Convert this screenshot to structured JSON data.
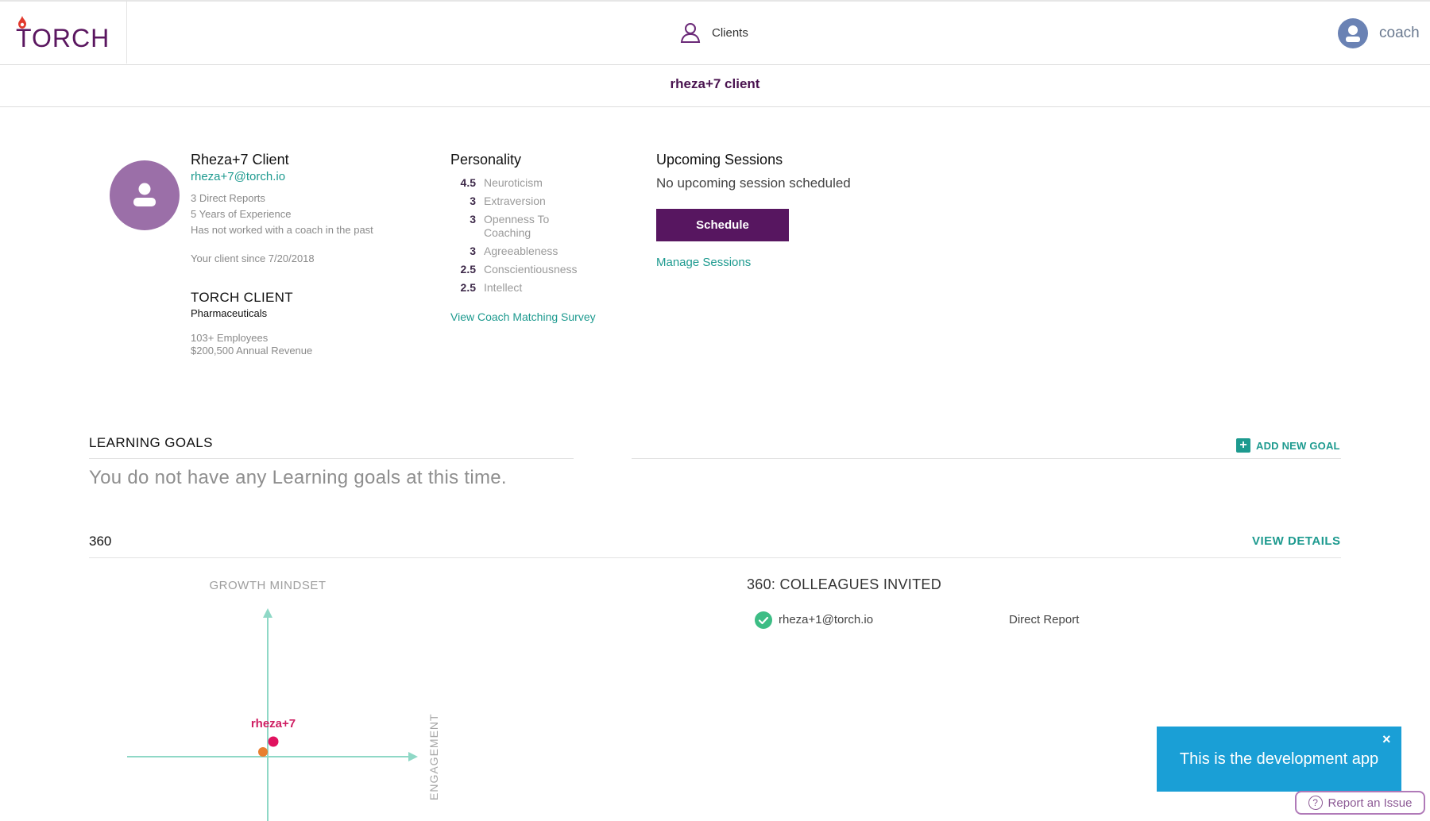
{
  "header": {
    "logo_text": "TORCH",
    "nav_clients": "Clients",
    "user_label": "coach"
  },
  "subheader": {
    "title": "rheza+7 client"
  },
  "client": {
    "name": "Rheza+7 Client",
    "email": "rheza+7@torch.io",
    "direct_reports": "3 Direct Reports",
    "experience": "5 Years of Experience",
    "coach_history": "Has not worked with a coach in the past",
    "client_since": "Your client since 7/20/2018"
  },
  "company": {
    "name": "TORCH CLIENT",
    "industry": "Pharmaceuticals",
    "employees": "103+ Employees",
    "revenue": "$200,500 Annual Revenue"
  },
  "personality": {
    "title": "Personality",
    "traits": [
      {
        "score": "4.5",
        "name": "Neuroticism"
      },
      {
        "score": "3",
        "name": "Extraversion"
      },
      {
        "score": "3",
        "name": "Openness To Coaching"
      },
      {
        "score": "3",
        "name": "Agreeableness"
      },
      {
        "score": "2.5",
        "name": "Conscientiousness"
      },
      {
        "score": "2.5",
        "name": "Intellect"
      }
    ],
    "survey_link": "View Coach Matching Survey"
  },
  "sessions": {
    "title": "Upcoming Sessions",
    "empty_text": "No upcoming session scheduled",
    "schedule_button": "Schedule",
    "manage_link": "Manage Sessions"
  },
  "learning_goals": {
    "title": "LEARNING GOALS",
    "add_button": "ADD NEW GOAL",
    "empty_text": "You do not have any Learning goals at this time."
  },
  "s360": {
    "title": "360",
    "view_details": "VIEW DETAILS",
    "chart_y_label": "GROWTH MINDSET",
    "chart_x_label": "ENGAGEMENT",
    "point_label": "rheza+7",
    "colleagues_title": "360: COLLEAGUES INVITED",
    "colleagues": [
      {
        "email": "rheza+1@torch.io",
        "role": "Direct Report"
      }
    ]
  },
  "dev_banner": {
    "text": "This is the development app",
    "close": "×",
    "report_issue": "Report an Issue"
  },
  "colors": {
    "brand_purple": "#571660",
    "accent_teal": "#1d9a8f",
    "banner_blue": "#1a9fd6"
  }
}
